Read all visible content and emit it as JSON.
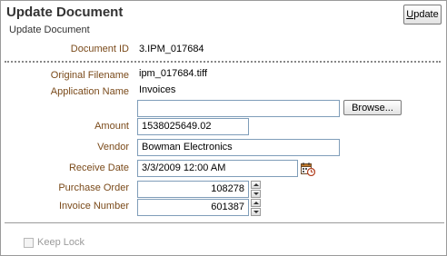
{
  "header": {
    "title": "Update Document",
    "subtitle": "Update Document",
    "update_button": {
      "label_hotkey": "U",
      "label_rest": "pdate"
    }
  },
  "fields": {
    "document_id": {
      "label": "Document ID",
      "value": "3.IPM_017684"
    },
    "original_filename": {
      "label": "Original Filename",
      "value": "ipm_017684.tiff"
    },
    "application_name": {
      "label": "Application Name",
      "value": "Invoices"
    },
    "file_upload": {
      "value": "",
      "browse_label": "Browse..."
    },
    "amount": {
      "label": "Amount",
      "value": "1538025649.02"
    },
    "vendor": {
      "label": "Vendor",
      "value": "Bowman Electronics"
    },
    "receive_date": {
      "label": "Receive Date",
      "value": "3/3/2009 12:00 AM",
      "icon": "calendar-icon"
    },
    "purchase_order": {
      "label": "Purchase Order",
      "value": "108278"
    },
    "invoice_number": {
      "label": "Invoice Number",
      "value": "601387"
    }
  },
  "footer": {
    "keep_lock": {
      "label": "Keep Lock",
      "checked": false,
      "disabled": true
    }
  },
  "colors": {
    "label": "#7a4a1a",
    "field_border": "#7f9db9",
    "frame_border": "#9a9a9a"
  }
}
